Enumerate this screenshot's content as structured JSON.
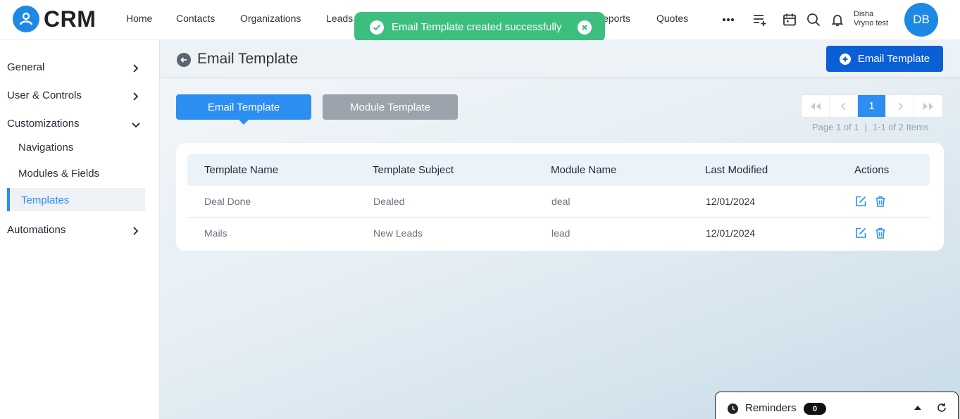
{
  "app": {
    "logo_text": "CRM"
  },
  "nav": {
    "items": [
      "Home",
      "Contacts",
      "Organizations",
      "Leads",
      "Reports",
      "Quotes"
    ],
    "more_icon": "more-dots-icon"
  },
  "user": {
    "first_name": "Disha",
    "last_name": "Vryno test",
    "initials": "DB"
  },
  "toast": {
    "message": "Email Template created successfully",
    "color": "#3cbf7e"
  },
  "sidebar": {
    "general": "General",
    "user_controls": "User & Controls",
    "customizations": "Customizations",
    "sub_items": [
      "Navigations",
      "Modules & Fields",
      "Templates"
    ],
    "automations": "Automations",
    "active_item": "Templates"
  },
  "page": {
    "title": "Email Template",
    "create_button": "Email Template"
  },
  "tabs": {
    "email": "Email Template",
    "module": "Module Template",
    "active": "Email Template"
  },
  "pagination": {
    "current_page": "1",
    "page_info": "Page 1 of 1",
    "items_info": "1-1 of 2 Items"
  },
  "table": {
    "headers": [
      "Template Name",
      "Template Subject",
      "Module Name",
      "Last Modified",
      "Actions"
    ],
    "rows": [
      {
        "name": "Deal Done",
        "subject": "Dealed",
        "module": "deal",
        "modified": "12/01/2024"
      },
      {
        "name": "Mails",
        "subject": "New Leads",
        "module": "lead",
        "modified": "12/01/2024"
      }
    ]
  },
  "reminders": {
    "label": "Reminders",
    "count": "0"
  },
  "colors": {
    "primary": "#1e88e5",
    "accent": "#2b8ef0",
    "create_button": "#0b5fd6",
    "success": "#3cbf7e"
  }
}
